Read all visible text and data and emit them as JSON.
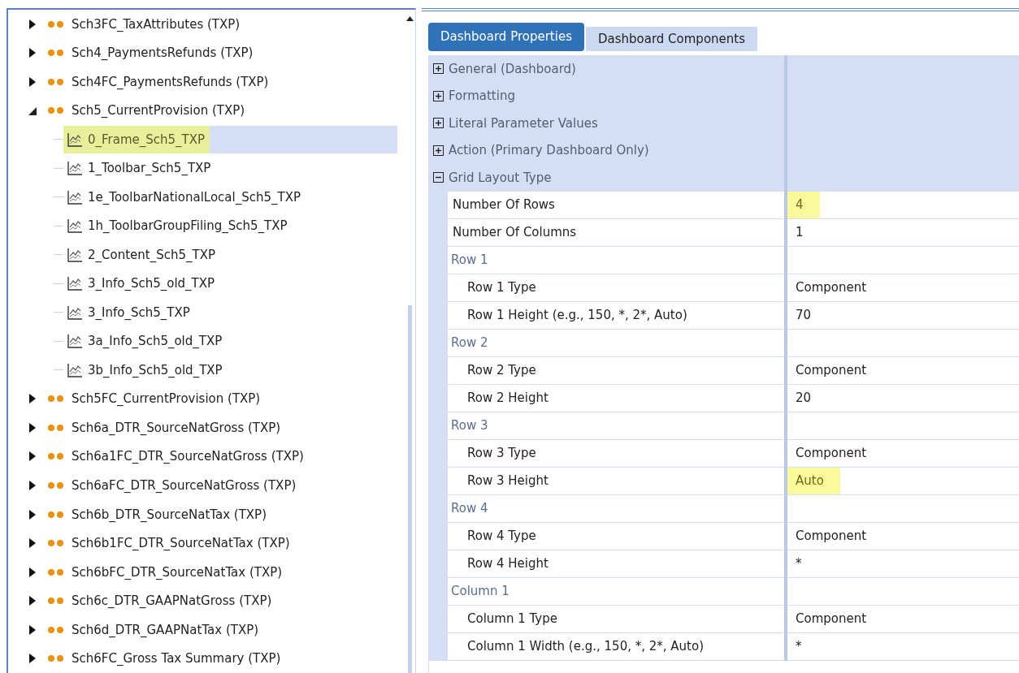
{
  "tree": [
    {
      "label": "Sch3FC_TaxAttributes (TXP)",
      "kind": "group",
      "expanded": false
    },
    {
      "label": "Sch4_PaymentsRefunds (TXP)",
      "kind": "group",
      "expanded": false
    },
    {
      "label": "Sch4FC_PaymentsRefunds (TXP)",
      "kind": "group",
      "expanded": false
    },
    {
      "label": "Sch5_CurrentProvision (TXP)",
      "kind": "group",
      "expanded": true,
      "children": [
        {
          "label": "0_Frame_Sch5_TXP",
          "kind": "dashboard",
          "selected": true,
          "highlighted": true
        },
        {
          "label": "1_Toolbar_Sch5_TXP",
          "kind": "dashboard",
          "selected": false,
          "highlighted": false
        },
        {
          "label": "1e_ToolbarNationalLocal_Sch5_TXP",
          "kind": "dashboard",
          "selected": false,
          "highlighted": false
        },
        {
          "label": "1h_ToolbarGroupFiling_Sch5_TXP",
          "kind": "dashboard",
          "selected": false,
          "highlighted": false
        },
        {
          "label": "2_Content_Sch5_TXP",
          "kind": "dashboard",
          "selected": false,
          "highlighted": false
        },
        {
          "label": "3_Info_Sch5_old_TXP",
          "kind": "dashboard",
          "selected": false,
          "highlighted": false
        },
        {
          "label": "3_Info_Sch5_TXP",
          "kind": "dashboard",
          "selected": false,
          "highlighted": false
        },
        {
          "label": "3a_Info_Sch5_old_TXP",
          "kind": "dashboard",
          "selected": false,
          "highlighted": false
        },
        {
          "label": "3b_Info_Sch5_old_TXP",
          "kind": "dashboard",
          "selected": false,
          "highlighted": false
        }
      ]
    },
    {
      "label": "Sch5FC_CurrentProvision (TXP)",
      "kind": "group",
      "expanded": false
    },
    {
      "label": "Sch6a_DTR_SourceNatGross (TXP)",
      "kind": "group",
      "expanded": false
    },
    {
      "label": "Sch6a1FC_DTR_SourceNatGross (TXP)",
      "kind": "group",
      "expanded": false
    },
    {
      "label": "Sch6aFC_DTR_SourceNatGross (TXP)",
      "kind": "group",
      "expanded": false
    },
    {
      "label": "Sch6b_DTR_SourceNatTax (TXP)",
      "kind": "group",
      "expanded": false
    },
    {
      "label": "Sch6b1FC_DTR_SourceNatTax (TXP)",
      "kind": "group",
      "expanded": false
    },
    {
      "label": "Sch6bFC_DTR_SourceNatTax (TXP)",
      "kind": "group",
      "expanded": false
    },
    {
      "label": "Sch6c_DTR_GAAPNatGross (TXP)",
      "kind": "group",
      "expanded": false
    },
    {
      "label": "Sch6d_DTR_GAAPNatTax (TXP)",
      "kind": "group",
      "expanded": false
    },
    {
      "label": "Sch6FC_Gross Tax Summary (TXP)",
      "kind": "group",
      "expanded": false
    }
  ],
  "tabs": [
    {
      "label": "Dashboard Properties",
      "selected": true
    },
    {
      "label": "Dashboard Components",
      "selected": false
    }
  ],
  "sections": [
    {
      "label": "General (Dashboard)",
      "expanded": false
    },
    {
      "label": "Formatting",
      "expanded": false
    },
    {
      "label": "Literal Parameter Values",
      "expanded": false
    },
    {
      "label": "Action (Primary Dashboard Only)",
      "expanded": false
    },
    {
      "label": "Grid Layout Type",
      "expanded": true,
      "rows": [
        {
          "kind": "property",
          "label": "Number Of Rows",
          "value": "4",
          "highlighted": true
        },
        {
          "kind": "property",
          "label": "Number Of Columns",
          "value": "1",
          "highlighted": false
        },
        {
          "kind": "group",
          "label": "Row 1"
        },
        {
          "kind": "subproperty",
          "label": "Row 1 Type",
          "value": "Component",
          "highlighted": false
        },
        {
          "kind": "subproperty",
          "label": "Row 1 Height (e.g., 150, *, 2*, Auto)",
          "value": "70",
          "highlighted": false
        },
        {
          "kind": "group",
          "label": "Row 2"
        },
        {
          "kind": "subproperty",
          "label": "Row 2 Type",
          "value": "Component",
          "highlighted": false
        },
        {
          "kind": "subproperty",
          "label": "Row 2 Height",
          "value": "20",
          "highlighted": false
        },
        {
          "kind": "group",
          "label": "Row 3"
        },
        {
          "kind": "subproperty",
          "label": "Row 3 Type",
          "value": "Component",
          "highlighted": false
        },
        {
          "kind": "subproperty",
          "label": "Row 3 Height",
          "value": "Auto",
          "highlighted": true
        },
        {
          "kind": "group",
          "label": "Row 4"
        },
        {
          "kind": "subproperty",
          "label": "Row 4 Type",
          "value": "Component",
          "highlighted": false
        },
        {
          "kind": "subproperty",
          "label": "Row 4 Height",
          "value": "*",
          "highlighted": false
        },
        {
          "kind": "group",
          "label": "Column 1"
        },
        {
          "kind": "subproperty",
          "label": "Column 1 Type",
          "value": "Component",
          "highlighted": false
        },
        {
          "kind": "subproperty",
          "label": "Column 1 Width (e.g., 150, *, 2*, Auto)",
          "value": "*",
          "highlighted": false
        }
      ]
    }
  ]
}
